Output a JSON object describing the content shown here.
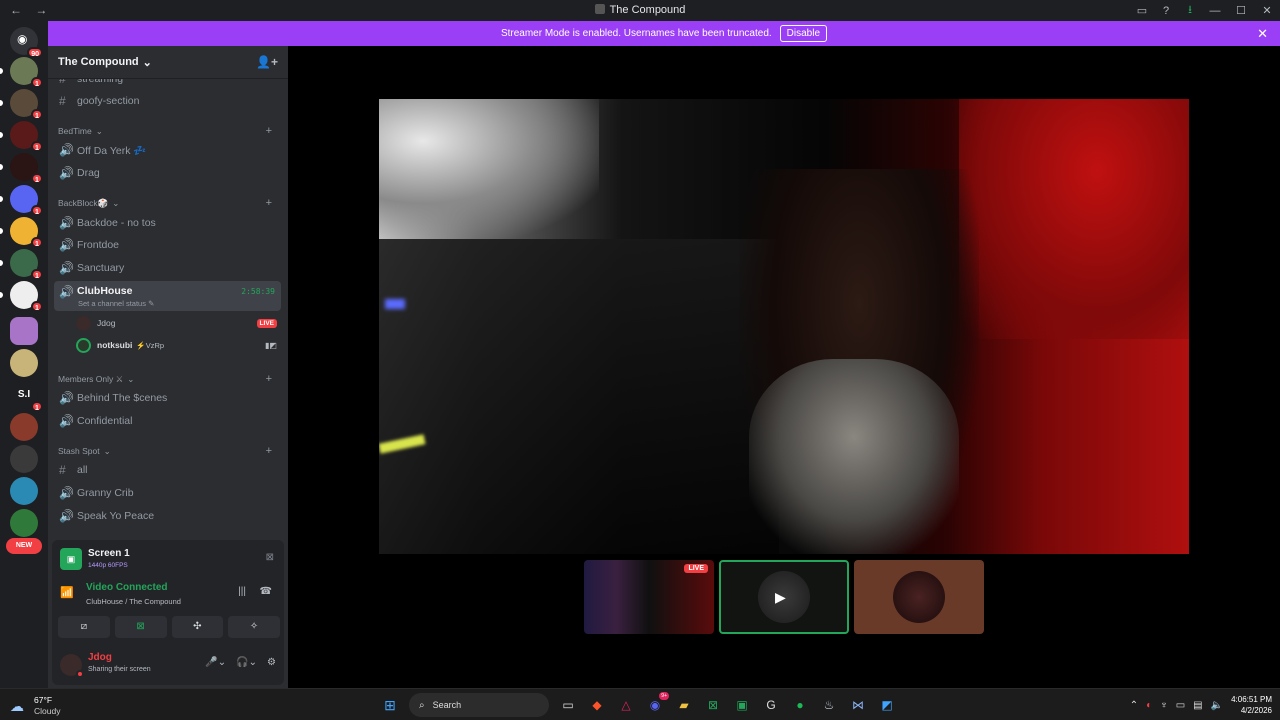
{
  "window": {
    "title": "The Compound",
    "nav_back": "←",
    "nav_forward": "→",
    "controls": [
      "—",
      "☐",
      "✕"
    ]
  },
  "banner": {
    "message": "Streamer Mode is enabled. Usernames have been truncated.",
    "disable_label": "Disable",
    "close": "✕"
  },
  "guilds": {
    "home_badge": "90",
    "badges": [
      "1",
      "1",
      "1",
      "1",
      "1",
      "1",
      "1",
      "1",
      "1",
      "1"
    ],
    "new_label": "NEW",
    "text_guild": "S.I"
  },
  "server": {
    "name": "The Compound",
    "chevron": "⌄",
    "invite_icon": "👤+"
  },
  "channels": {
    "top": [
      {
        "name": "streaming",
        "type": "text"
      },
      {
        "name": "goofy-section",
        "type": "text"
      }
    ],
    "categories": [
      {
        "name": "BedTime",
        "channels": [
          {
            "name": "Off Da Yerk 💤",
            "type": "voice"
          },
          {
            "name": "Drag",
            "type": "voice"
          }
        ]
      },
      {
        "name": "BackBlock🎲",
        "channels": [
          {
            "name": "Backdoe - no tos",
            "type": "voice"
          },
          {
            "name": "Frontdoe",
            "type": "voice"
          },
          {
            "name": "Sanctuary",
            "type": "voice"
          }
        ]
      },
      {
        "name": "Members Only ⚔",
        "channels": [
          {
            "name": "Behind The $cenes",
            "type": "voice"
          },
          {
            "name": "Confidential",
            "type": "voice"
          }
        ]
      },
      {
        "name": "Stash Spot",
        "channels": [
          {
            "name": "all",
            "type": "text"
          },
          {
            "name": "Granny Crib",
            "type": "voice"
          },
          {
            "name": "Speak Yo Peace",
            "type": "voice"
          }
        ]
      }
    ],
    "active": {
      "name": "ClubHouse",
      "timer": "2:58:39",
      "status": "Set a channel status"
    },
    "voice_users": [
      {
        "name": "Jdog",
        "badge": "LIVE"
      },
      {
        "name": "notksubi",
        "suffix": "⚡VzRp"
      }
    ]
  },
  "panel": {
    "screen": {
      "name": "Screen 1",
      "meta": "1440p 60FPS"
    },
    "voice": {
      "status": "Video Connected",
      "location": "ClubHouse / The Compound"
    },
    "user": {
      "name": "Jdog",
      "status": "Sharing their screen"
    }
  },
  "stage": {
    "thumb_live": "LIVE"
  },
  "taskbar": {
    "temp": "67°F",
    "condition": "Cloudy",
    "search": "Search",
    "discord_badge": "9+",
    "time": "4:06:51 PM",
    "date": "4/2/2026"
  }
}
